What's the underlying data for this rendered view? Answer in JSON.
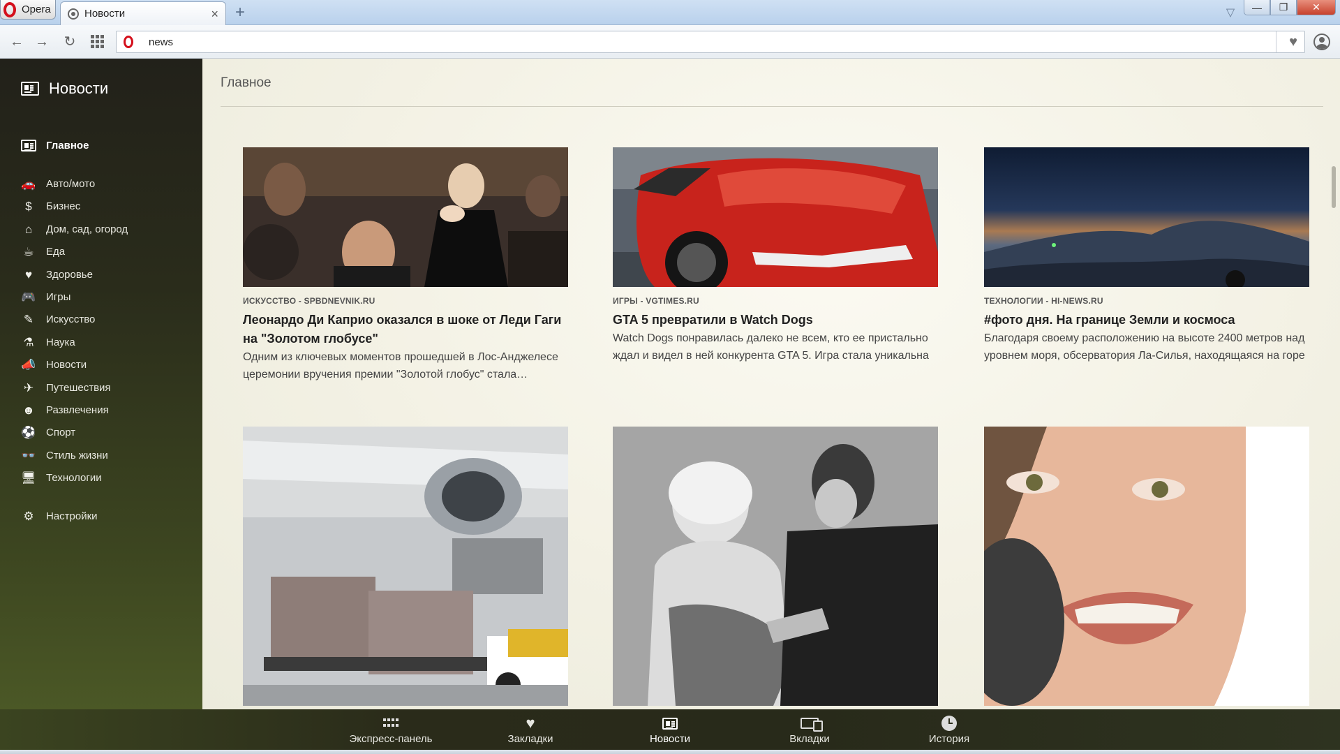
{
  "window": {
    "app_button_label": "Opera",
    "tab_title": "Новости",
    "tab_close": "×",
    "new_tab": "+",
    "minimize": "—",
    "restore": "❐",
    "close": "✕"
  },
  "toolbar": {
    "back": "←",
    "forward": "→",
    "reload": "↻",
    "url_value": "news",
    "bookmark_heart": "♥"
  },
  "sidebar": {
    "header": "Новости",
    "main_item": "Главное",
    "categories": [
      {
        "label": "Авто/мото",
        "icon": "car-icon",
        "glyph": "🚗"
      },
      {
        "label": "Бизнес",
        "icon": "dollar-icon",
        "glyph": "$"
      },
      {
        "label": "Дом, сад, огород",
        "icon": "home-icon",
        "glyph": "⌂"
      },
      {
        "label": "Еда",
        "icon": "food-icon",
        "glyph": "☕"
      },
      {
        "label": "Здоровье",
        "icon": "heart-pulse-icon",
        "glyph": "♥"
      },
      {
        "label": "Игры",
        "icon": "gamepad-icon",
        "glyph": "🎮"
      },
      {
        "label": "Искусство",
        "icon": "brush-icon",
        "glyph": "✎"
      },
      {
        "label": "Наука",
        "icon": "flask-icon",
        "glyph": "⚗"
      },
      {
        "label": "Новости",
        "icon": "megaphone-icon",
        "glyph": "📣"
      },
      {
        "label": "Путешествия",
        "icon": "plane-icon",
        "glyph": "✈"
      },
      {
        "label": "Развлечения",
        "icon": "mask-icon",
        "glyph": "☻"
      },
      {
        "label": "Спорт",
        "icon": "ball-icon",
        "glyph": "⚽"
      },
      {
        "label": "Стиль жизни",
        "icon": "glasses-icon",
        "glyph": "👓"
      },
      {
        "label": "Технологии",
        "icon": "monitor-icon",
        "glyph": "🖥"
      }
    ],
    "settings": "Настройки",
    "settings_glyph": "⚙"
  },
  "main": {
    "section_title": "Главное",
    "cards": [
      {
        "source": "ИСКУССТВО - SPBDNEVNIK.RU",
        "title": "Леонардо Ди Каприо оказался в шоке от Леди Гаги на \"Золотом глобусе\"",
        "desc": "Одним из ключевых моментов прошедшей в Лос-Анджелесе церемонии вручения премии \"Золотой глобус\" стала…"
      },
      {
        "source": "ИГРЫ - VGTIMES.RU",
        "title": "GTA 5 превратили в Watch Dogs",
        "desc": "Watch Dogs понравилась далеко не всем, кто ее пристально ждал и видел в ней конкурента GTA 5. Игра стала уникальна тем, что предлагала геймерам стать настоящими хакерам…"
      },
      {
        "source": "ТЕХНОЛОГИИ - HI-NEWS.RU",
        "title": "#фото дня. На границе Земли и космоса",
        "desc": "Благодаря своему расположению на высоте 2400 метров над уровнем моря, обсерватория Ла-Силья, находящаяся на горе в южной части чилийской пустыни Атаками, облада…"
      }
    ]
  },
  "bottom_nav": [
    {
      "label": "Экспресс-панель",
      "icon": "speed-dial-icon"
    },
    {
      "label": "Закладки",
      "icon": "heart-icon"
    },
    {
      "label": "Новости",
      "icon": "news-icon"
    },
    {
      "label": "Вкладки",
      "icon": "tabs-icon"
    },
    {
      "label": "История",
      "icon": "history-icon"
    }
  ],
  "colors": {
    "opera_red": "#d40f1b",
    "sidebar_dark": "#22211a",
    "sidebar_olive": "#4b5826",
    "content_bg": "#f3f1e4"
  }
}
